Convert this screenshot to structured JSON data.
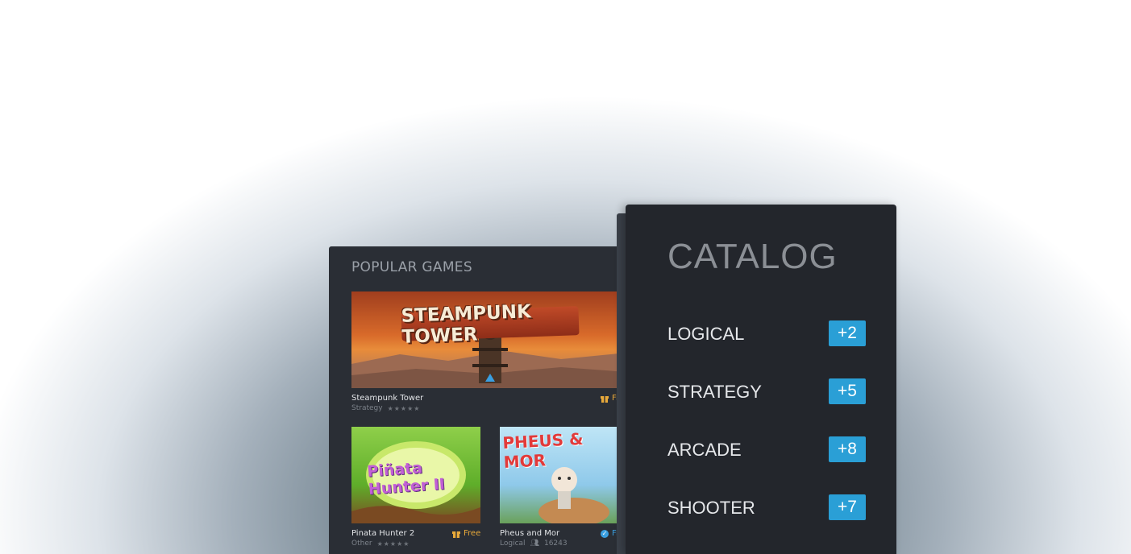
{
  "popular_games": {
    "title": "POPULAR GAMES",
    "featured": {
      "art_title": "STEAMPUNK TOWER",
      "name": "Steampunk Tower",
      "genre": "Strategy",
      "rating_stars": "★★★★★",
      "badge": "Free",
      "badge_icon": "gift-icon"
    },
    "games": [
      {
        "art_title": "Piñata Hunter II",
        "name": "Pinata Hunter 2",
        "genre": "Other",
        "rating_stars": "★★★★★",
        "badge": "Free",
        "badge_icon": "gift-icon"
      },
      {
        "art_title": "PHEUS & MOR",
        "name": "Pheus and Mor",
        "genre": "Logical",
        "players": "16243",
        "badge": "Free",
        "badge_icon": "check-circle-icon"
      }
    ]
  },
  "catalog": {
    "title": "CATALOG",
    "categories": [
      {
        "label": "LOGICAL",
        "count": "+2"
      },
      {
        "label": "STRATEGY",
        "count": "+5"
      },
      {
        "label": "ARCADE",
        "count": "+8"
      },
      {
        "label": "SHOOTER",
        "count": "+7"
      }
    ]
  },
  "colors": {
    "accent": "#2a9fd6",
    "free_badge": "#e8a93a",
    "panel_bg": "#23262c"
  }
}
